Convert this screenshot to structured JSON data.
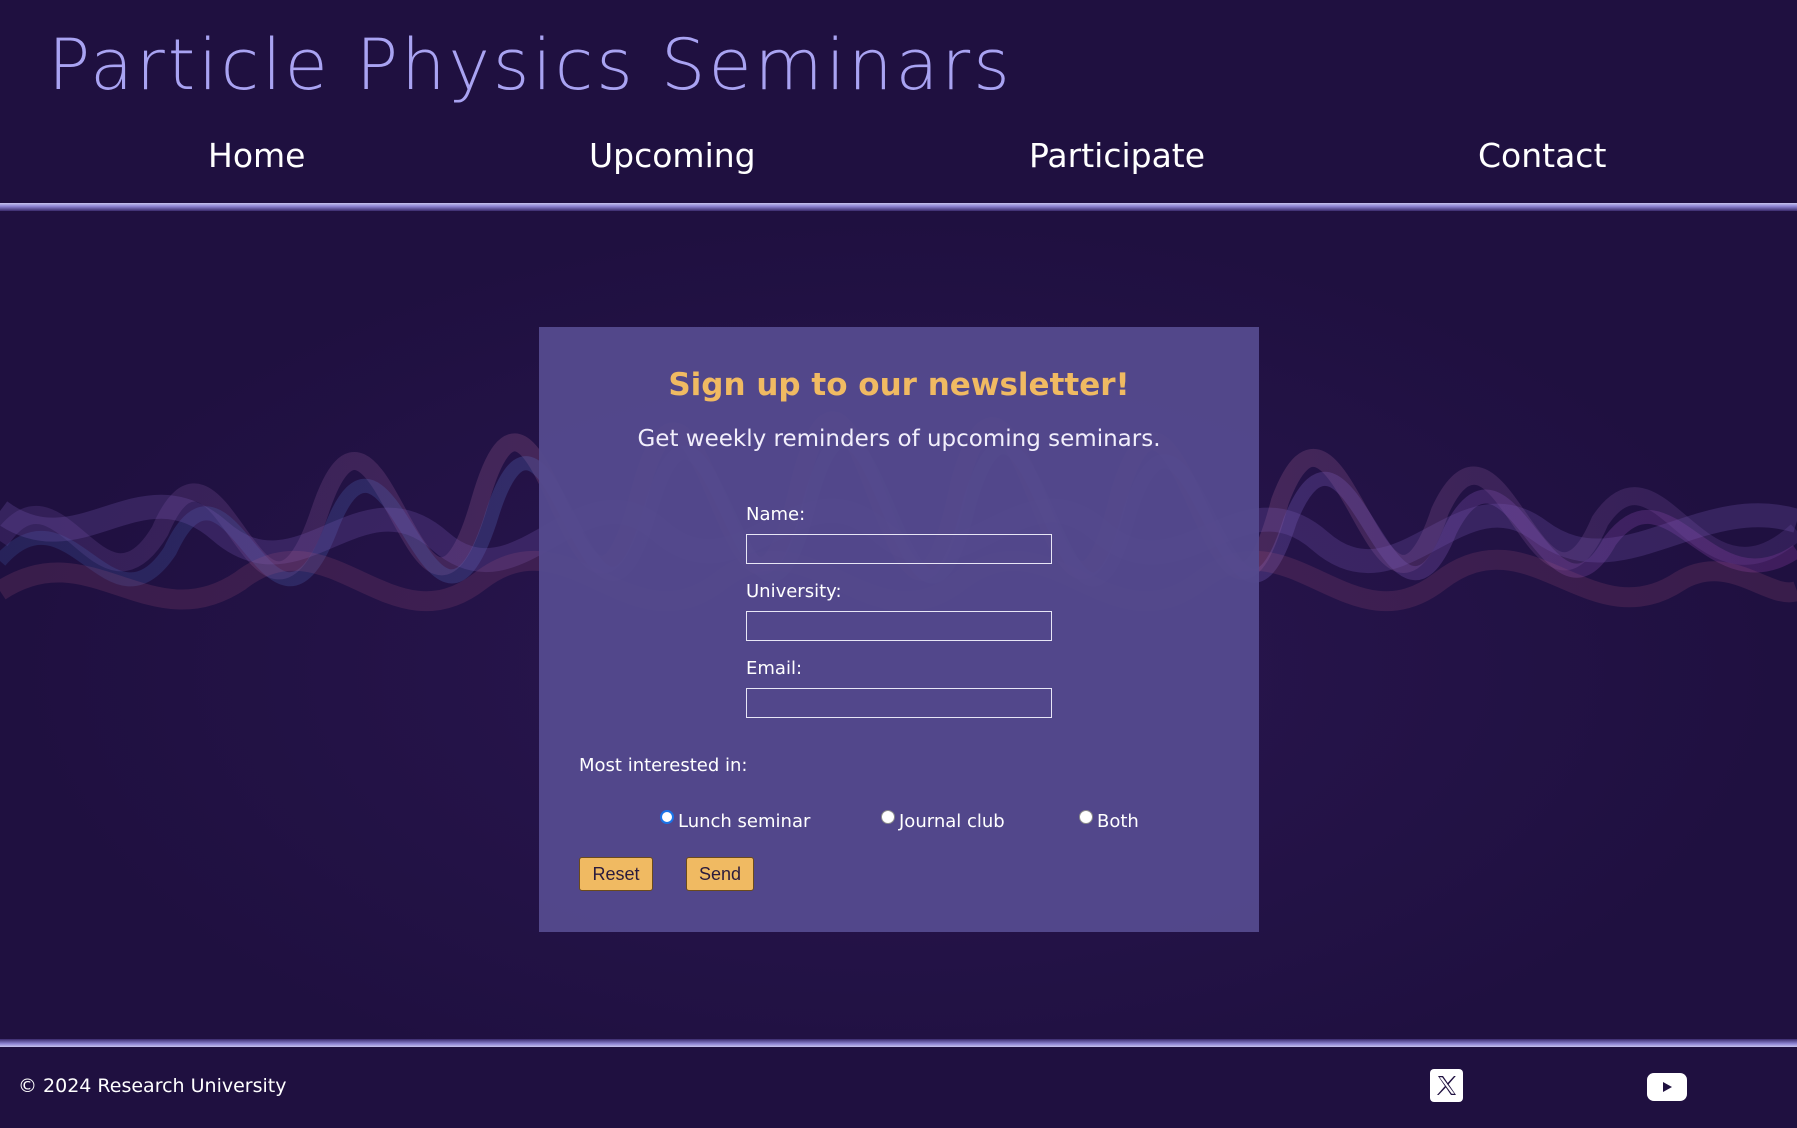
{
  "site": {
    "title": "Particle Physics Seminars"
  },
  "nav": {
    "items": [
      {
        "label": "Home"
      },
      {
        "label": "Upcoming"
      },
      {
        "label": "Participate"
      },
      {
        "label": "Contact"
      }
    ]
  },
  "newsletter": {
    "title": "Sign up to our newsletter!",
    "subtitle": "Get weekly reminders of upcoming seminars.",
    "fields": [
      {
        "label": "Name:",
        "value": ""
      },
      {
        "label": "University:",
        "value": ""
      },
      {
        "label": "Email:",
        "value": ""
      }
    ],
    "interest_label": "Most interested in:",
    "options": [
      {
        "label": "Lunch seminar",
        "selected": false
      },
      {
        "label": "Journal club",
        "selected": false
      },
      {
        "label": "Both",
        "selected": false
      }
    ],
    "reset_label": "Reset",
    "send_label": "Send"
  },
  "footer": {
    "copyright": "© 2024 Research University",
    "social": [
      {
        "icon": "x-twitter-icon"
      },
      {
        "icon": "youtube-icon"
      }
    ]
  },
  "colors": {
    "background": "#1f1040",
    "title": "#a9a3f2",
    "card": "#544a8e",
    "accent": "#f0ba62"
  }
}
